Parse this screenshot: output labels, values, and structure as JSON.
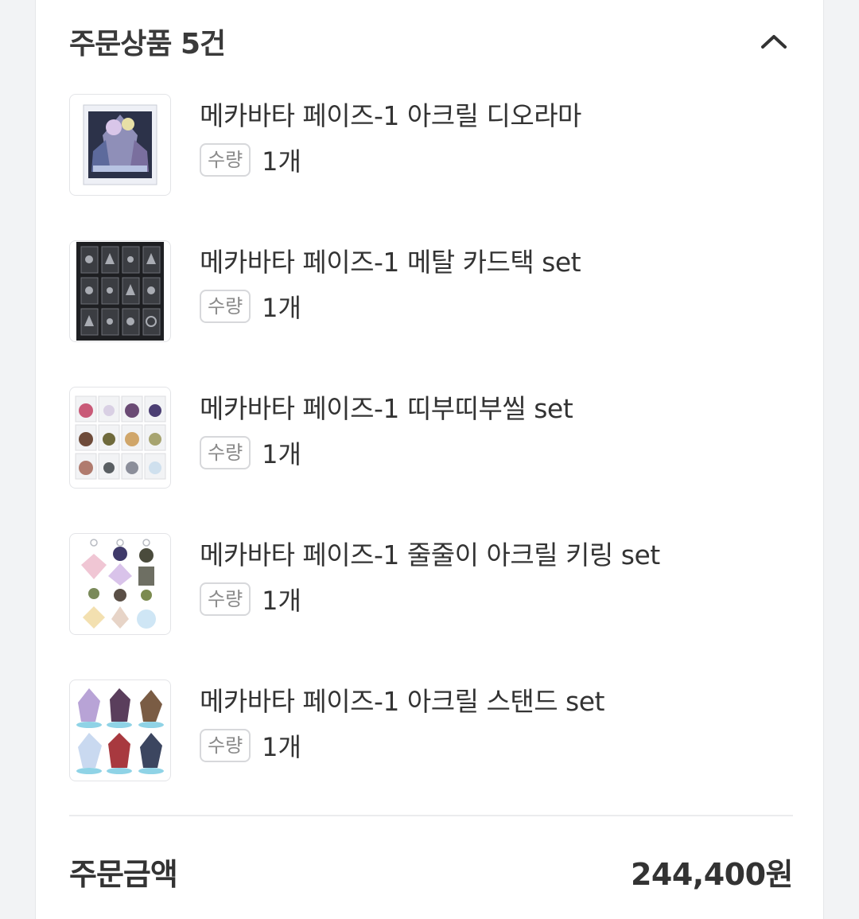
{
  "section": {
    "title": "주문상품 5건",
    "collapse_icon": "chevron-up-icon"
  },
  "items": [
    {
      "name": "메카바타 페이즈-1 아크릴 디오라마",
      "qty_label": "수량",
      "qty_value": "1개"
    },
    {
      "name": "메카바타 페이즈-1 메탈 카드택 set",
      "qty_label": "수량",
      "qty_value": "1개"
    },
    {
      "name": "메카바타 페이즈-1 띠부띠부씰 set",
      "qty_label": "수량",
      "qty_value": "1개"
    },
    {
      "name": "메카바타 페이즈-1 줄줄이 아크릴 키링 set",
      "qty_label": "수량",
      "qty_value": "1개"
    },
    {
      "name": "메카바타 페이즈-1 아크릴 스탠드 set",
      "qty_label": "수량",
      "qty_value": "1개"
    }
  ],
  "total": {
    "label": "주문금액",
    "value": "244,400원"
  },
  "colors": {
    "background": "#f2f3f5",
    "card": "#ffffff",
    "text": "#333333",
    "badge_border": "#d7d8db",
    "badge_text": "#8a8a8a"
  }
}
